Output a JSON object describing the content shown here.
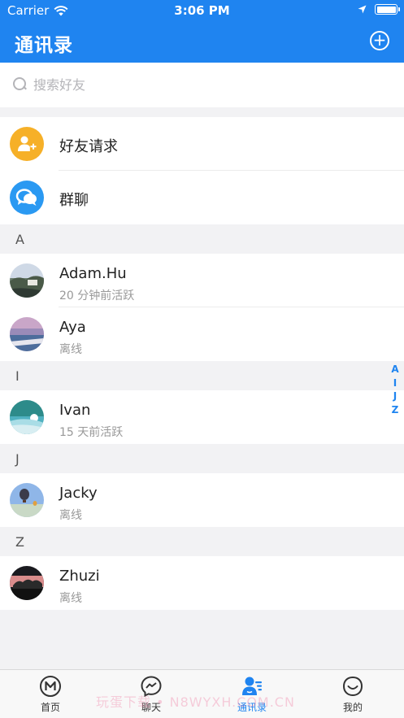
{
  "status_bar": {
    "carrier": "Carrier",
    "time": "3:06 PM"
  },
  "nav": {
    "title": "通讯录",
    "add_icon": "plus-circle-icon"
  },
  "search": {
    "placeholder": "搜索好友"
  },
  "fixed_items": [
    {
      "label": "好友请求",
      "icon": "add-user-icon",
      "color": "#f6b028"
    },
    {
      "label": "群聊",
      "icon": "group-chat-icon",
      "color": "#2a99f2"
    }
  ],
  "sections": [
    {
      "letter": "A",
      "contacts": [
        {
          "name": "Adam.Hu",
          "status": "20 分钟前活跃"
        },
        {
          "name": "Aya",
          "status": "离线"
        }
      ]
    },
    {
      "letter": "I",
      "contacts": [
        {
          "name": "Ivan",
          "status": "15 天前活跃"
        }
      ]
    },
    {
      "letter": "J",
      "contacts": [
        {
          "name": "Jacky",
          "status": "离线"
        }
      ]
    },
    {
      "letter": "Z",
      "contacts": [
        {
          "name": "Zhuzi",
          "status": "离线"
        }
      ]
    }
  ],
  "index": [
    "A",
    "I",
    "J",
    "Z"
  ],
  "tabs": [
    {
      "label": "首页",
      "icon": "home-m-icon",
      "active": false
    },
    {
      "label": "聊天",
      "icon": "messenger-icon",
      "active": false
    },
    {
      "label": "通讯录",
      "icon": "contacts-icon",
      "active": true
    },
    {
      "label": "我的",
      "icon": "smile-icon",
      "active": false
    }
  ],
  "watermark": "玩蛋下载 • N8WYXH.COM.CN",
  "colors": {
    "primary": "#1f84f0",
    "background": "#f2f2f4"
  }
}
